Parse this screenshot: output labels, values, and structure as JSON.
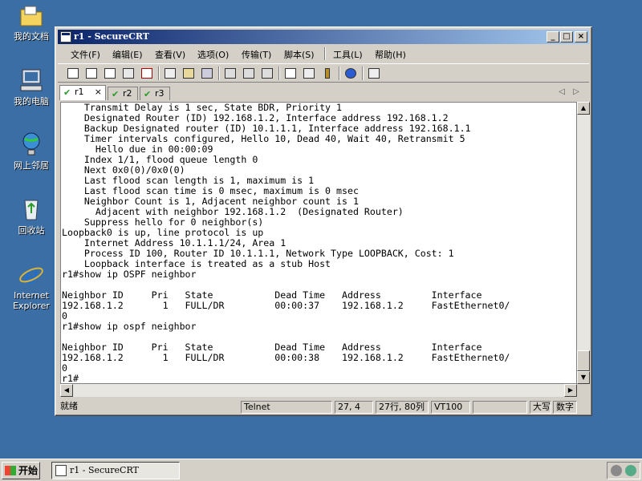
{
  "desktop": {
    "icons": [
      {
        "label": "我的文档",
        "icon": "folder-documents-icon"
      },
      {
        "label": "我的电脑",
        "icon": "computer-icon"
      },
      {
        "label": "网上邻居",
        "icon": "network-icon"
      },
      {
        "label": "回收站",
        "icon": "recycle-bin-icon"
      },
      {
        "label": "Internet Explorer",
        "icon": "internet-explorer-icon"
      }
    ]
  },
  "window": {
    "title": "r1 - SecureCRT",
    "controls": {
      "minimize": "_",
      "maximize": "□",
      "close": "×"
    }
  },
  "menu": [
    "文件(F)",
    "编辑(E)",
    "查看(V)",
    "选项(O)",
    "传输(T)",
    "脚本(S)",
    "工具(L)",
    "帮助(H)"
  ],
  "tabs": [
    {
      "label": "r1",
      "close": "×",
      "active": true
    },
    {
      "label": "r2",
      "active": false
    },
    {
      "label": "r3",
      "active": false
    }
  ],
  "terminal": {
    "lines": [
      "    Transmit Delay is 1 sec, State BDR, Priority 1",
      "    Designated Router (ID) 192.168.1.2, Interface address 192.168.1.2",
      "    Backup Designated router (ID) 10.1.1.1, Interface address 192.168.1.1",
      "    Timer intervals configured, Hello 10, Dead 40, Wait 40, Retransmit 5",
      "      Hello due in 00:00:09",
      "    Index 1/1, flood queue length 0",
      "    Next 0x0(0)/0x0(0)",
      "    Last flood scan length is 1, maximum is 1",
      "    Last flood scan time is 0 msec, maximum is 0 msec",
      "    Neighbor Count is 1, Adjacent neighbor count is 1",
      "      Adjacent with neighbor 192.168.1.2  (Designated Router)",
      "    Suppress hello for 0 neighbor(s)",
      "Loopback0 is up, line protocol is up",
      "    Internet Address 10.1.1.1/24, Area 1",
      "    Process ID 100, Router ID 10.1.1.1, Network Type LOOPBACK, Cost: 1",
      "    Loopback interface is treated as a stub Host",
      "r1#show ip OSPF neighbor",
      "",
      "Neighbor ID     Pri   State           Dead Time   Address         Interface",
      "192.168.1.2       1   FULL/DR         00:00:37    192.168.1.2     FastEthernet0/",
      "0",
      "r1#show ip ospf neighbor",
      "",
      "Neighbor ID     Pri   State           Dead Time   Address         Interface",
      "192.168.1.2       1   FULL/DR         00:00:38    192.168.1.2     FastEthernet0/",
      "0",
      "r1#"
    ]
  },
  "status": {
    "ready": "就绪",
    "protocol": "Telnet",
    "cursor": "27,  4",
    "size": "27行, 80列",
    "emulation": "VT100",
    "blank": "",
    "caps": "大写",
    "num": "数字"
  },
  "taskbar": {
    "start": "开始",
    "task": "r1 - SecureCRT"
  }
}
